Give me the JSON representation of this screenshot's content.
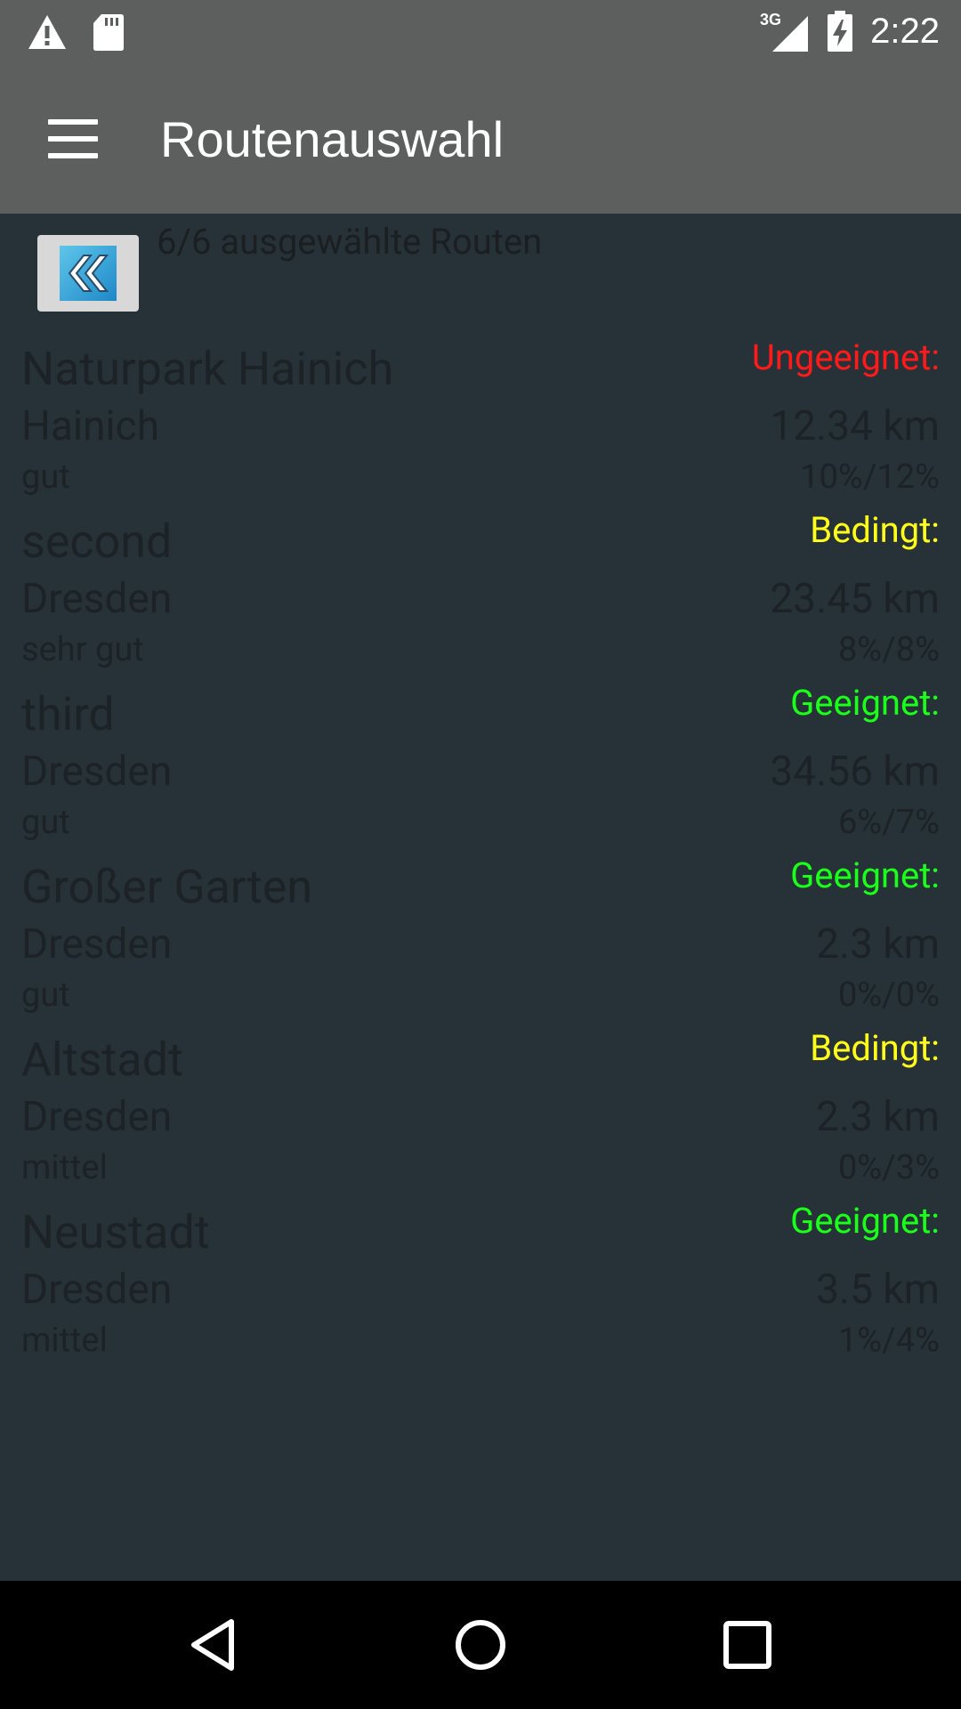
{
  "status_bar": {
    "time": "2:22",
    "network": "3G",
    "icons": [
      "warning-icon",
      "sd-card-icon",
      "signal-icon",
      "battery-icon"
    ]
  },
  "app_bar": {
    "title": "Routenauswahl",
    "menu_icon": "hamburger-menu-icon"
  },
  "selection": {
    "count_text": "6/6 ausgewählte Routen",
    "back_icon": "double-chevron-left-icon"
  },
  "routes": [
    {
      "name": "Naturpark Hainich",
      "status": "Ungeeignet:",
      "status_color": "#ff1a1a",
      "city": "Hainich",
      "distance": "12.34 km",
      "condition": "gut",
      "slope": "10%/12%"
    },
    {
      "name": "second",
      "status": "Bedingt:",
      "status_color": "#ffff1a",
      "city": "Dresden",
      "distance": "23.45 km",
      "condition": "sehr gut",
      "slope": "8%/8%"
    },
    {
      "name": "third",
      "status": "Geeignet:",
      "status_color": "#1aff1a",
      "city": "Dresden",
      "distance": "34.56 km",
      "condition": "gut",
      "slope": "6%/7%"
    },
    {
      "name": "Großer Garten",
      "status": "Geeignet:",
      "status_color": "#1aff1a",
      "city": "Dresden",
      "distance": "2.3 km",
      "condition": "gut",
      "slope": "0%/0%"
    },
    {
      "name": "Altstadt",
      "status": "Bedingt:",
      "status_color": "#ffff1a",
      "city": "Dresden",
      "distance": "2.3 km",
      "condition": "mittel",
      "slope": "0%/3%"
    },
    {
      "name": "Neustadt",
      "status": "Geeignet:",
      "status_color": "#1aff1a",
      "city": "Dresden",
      "distance": "3.5 km",
      "condition": "mittel",
      "slope": "1%/4%"
    }
  ],
  "nav_bar": {
    "icons": [
      "back-triangle-icon",
      "home-circle-icon",
      "recents-square-icon"
    ]
  }
}
